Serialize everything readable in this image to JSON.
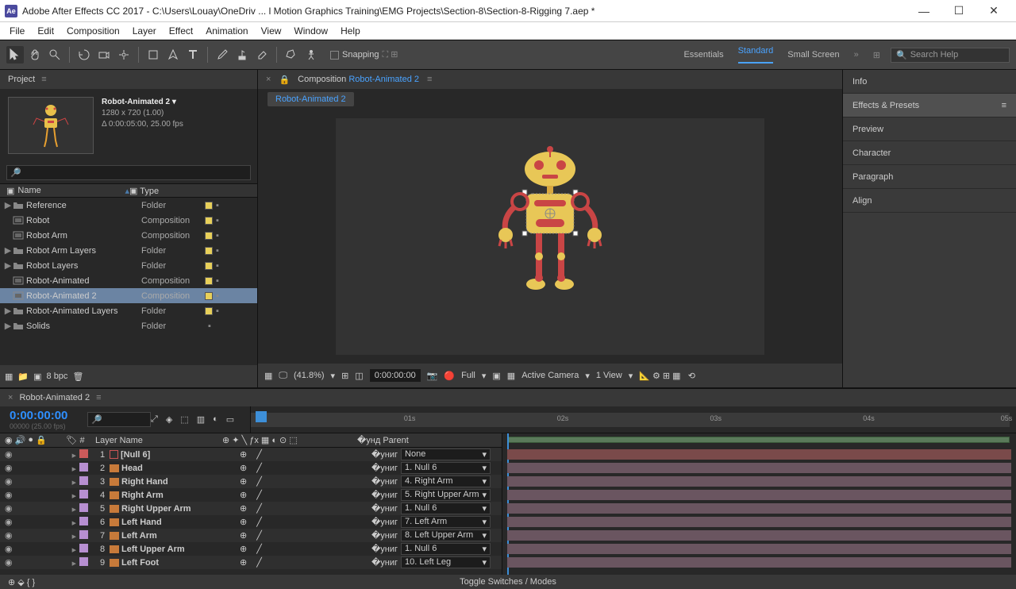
{
  "title": "Adobe After Effects CC 2017 - C:\\Users\\Louay\\OneDriv ... l Motion Graphics Training\\EMG Projects\\Section-8\\Section-8-Rigging 7.aep *",
  "menu": [
    "File",
    "Edit",
    "Composition",
    "Layer",
    "Effect",
    "Animation",
    "View",
    "Window",
    "Help"
  ],
  "snapping": "Snapping",
  "workspaces": {
    "items": [
      "Essentials",
      "Standard",
      "Small Screen"
    ],
    "active": "Standard"
  },
  "searchHelp": "Search Help",
  "project": {
    "tab": "Project",
    "name": "Robot-Animated 2 ▾",
    "dims": "1280 x 720 (1.00)",
    "dur": "Δ 0:00:05:00, 25.00 fps",
    "cols": {
      "name": "Name",
      "type": "Type"
    },
    "items": [
      {
        "icon": "folder",
        "name": "Reference",
        "type": "Folder",
        "sw": true,
        "arrow": true
      },
      {
        "icon": "comp",
        "name": "Robot",
        "type": "Composition",
        "sw": true
      },
      {
        "icon": "comp",
        "name": "Robot Arm",
        "type": "Composition",
        "sw": true
      },
      {
        "icon": "folder",
        "name": "Robot Arm Layers",
        "type": "Folder",
        "sw": true,
        "arrow": true
      },
      {
        "icon": "folder",
        "name": "Robot Layers",
        "type": "Folder",
        "sw": true,
        "arrow": true
      },
      {
        "icon": "comp",
        "name": "Robot-Animated",
        "type": "Composition",
        "sw": true
      },
      {
        "icon": "comp",
        "name": "Robot-Animated 2",
        "type": "Composition",
        "sw": true,
        "sel": true
      },
      {
        "icon": "folder",
        "name": "Robot-Animated Layers",
        "type": "Folder",
        "sw": true,
        "arrow": true
      },
      {
        "icon": "folder",
        "name": "Solids",
        "type": "Folder",
        "arrow": true
      }
    ],
    "bpc": "8 bpc"
  },
  "comp": {
    "tabPrefix": "Composition",
    "tabName": "Robot-Animated 2",
    "crumb": "Robot-Animated 2",
    "footer": {
      "zoom": "(41.8%)",
      "time": "0:00:00:00",
      "res": "Full",
      "camera": "Active Camera",
      "view": "1 View"
    }
  },
  "rightPanels": [
    "Info",
    "Effects & Presets",
    "Preview",
    "Character",
    "Paragraph",
    "Align"
  ],
  "timeline": {
    "tab": "Robot-Animated 2",
    "timecode": "0:00:00:00",
    "fps": "00000 (25.00 fps)",
    "ruler": [
      "01s",
      "02s",
      "03s",
      "04s",
      "05s"
    ],
    "cols": {
      "num": "#",
      "name": "Layer Name",
      "parent": "Parent"
    },
    "layers": [
      {
        "num": 1,
        "color": "#cc5a5a",
        "name": "[Null 6]",
        "parent": "None",
        "null": true
      },
      {
        "num": 2,
        "color": "#b78fd1",
        "name": "Head",
        "parent": "1. Null 6"
      },
      {
        "num": 3,
        "color": "#b78fd1",
        "name": "Right Hand",
        "parent": "4. Right Arm"
      },
      {
        "num": 4,
        "color": "#b78fd1",
        "name": "Right Arm",
        "parent": "5. Right Upper Arm"
      },
      {
        "num": 5,
        "color": "#b78fd1",
        "name": "Right Upper Arm",
        "parent": "1. Null 6"
      },
      {
        "num": 6,
        "color": "#b78fd1",
        "name": "Left Hand",
        "parent": "7. Left Arm"
      },
      {
        "num": 7,
        "color": "#b78fd1",
        "name": "Left Arm",
        "parent": "8. Left Upper Arm"
      },
      {
        "num": 8,
        "color": "#b78fd1",
        "name": "Left Upper Arm",
        "parent": "1. Null 6"
      },
      {
        "num": 9,
        "color": "#b78fd1",
        "name": "Left Foot",
        "parent": "10. Left Leg"
      }
    ],
    "toggle": "Toggle Switches / Modes"
  }
}
